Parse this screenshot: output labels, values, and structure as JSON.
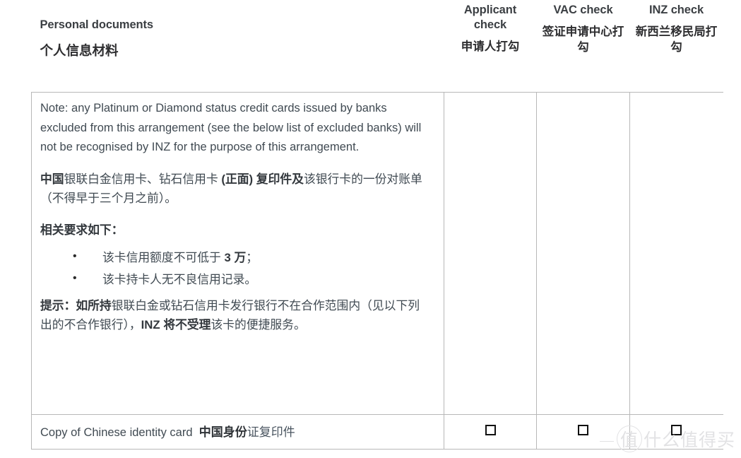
{
  "table": {
    "header": {
      "description_en": "Personal documents",
      "description_zh": "个人信息材料",
      "columns": [
        {
          "en": "Applicant check",
          "zh": "申请人打勾"
        },
        {
          "en": "VAC check",
          "zh": "签证申请中心打勾"
        },
        {
          "en": "INZ check",
          "zh": "新西兰移民局打勾"
        }
      ]
    },
    "rows": [
      {
        "note_en": "Note: any Platinum or Diamond status credit cards issued by banks excluded from this arrangement (see the below list of excluded banks) will not be recognised by INZ for the purpose of this arrangement.",
        "card_line_bold_1": "中国",
        "card_line_plain_1": "银联白金信用卡、钻石信用卡 ",
        "card_line_bold_2": "(正面) 复印件及",
        "card_line_plain_2": "该银行卡的一份对账单（不得早于三个月之前）。",
        "requirements_heading": "相关要求如下：",
        "requirements": [
          {
            "bullet": "•",
            "plain_1": "该卡信用额度不可低于 ",
            "bold": "3 万",
            "plain_2": "；"
          },
          {
            "bullet": "•",
            "plain_1": "该卡持卡人无不良信用记录。",
            "bold": "",
            "plain_2": ""
          }
        ],
        "hint_bold_1": "提示：如所持",
        "hint_plain_1": "银联白金或钻石信用卡发行银行不在合作范围内（见以下列出的不合作银行），",
        "hint_bold_2": "INZ 将不受理",
        "hint_plain_2": "该卡的便捷服务。",
        "checkboxes": [
          "",
          "",
          ""
        ]
      },
      {
        "label_en": "Copy of Chinese identity card",
        "label_zh_bold": "中国身份",
        "label_zh_plain": "证复印件",
        "checkboxes": [
          "☐",
          "☐",
          "☐"
        ]
      }
    ]
  },
  "watermark": {
    "circle_char": "值",
    "text": "什么值得买"
  },
  "colors": {
    "border": "#b8b8b8",
    "body_text": "#404a52",
    "bold_text": "#33383d",
    "checkbox_border": "#111111",
    "watermark": "#e2e2e4"
  }
}
